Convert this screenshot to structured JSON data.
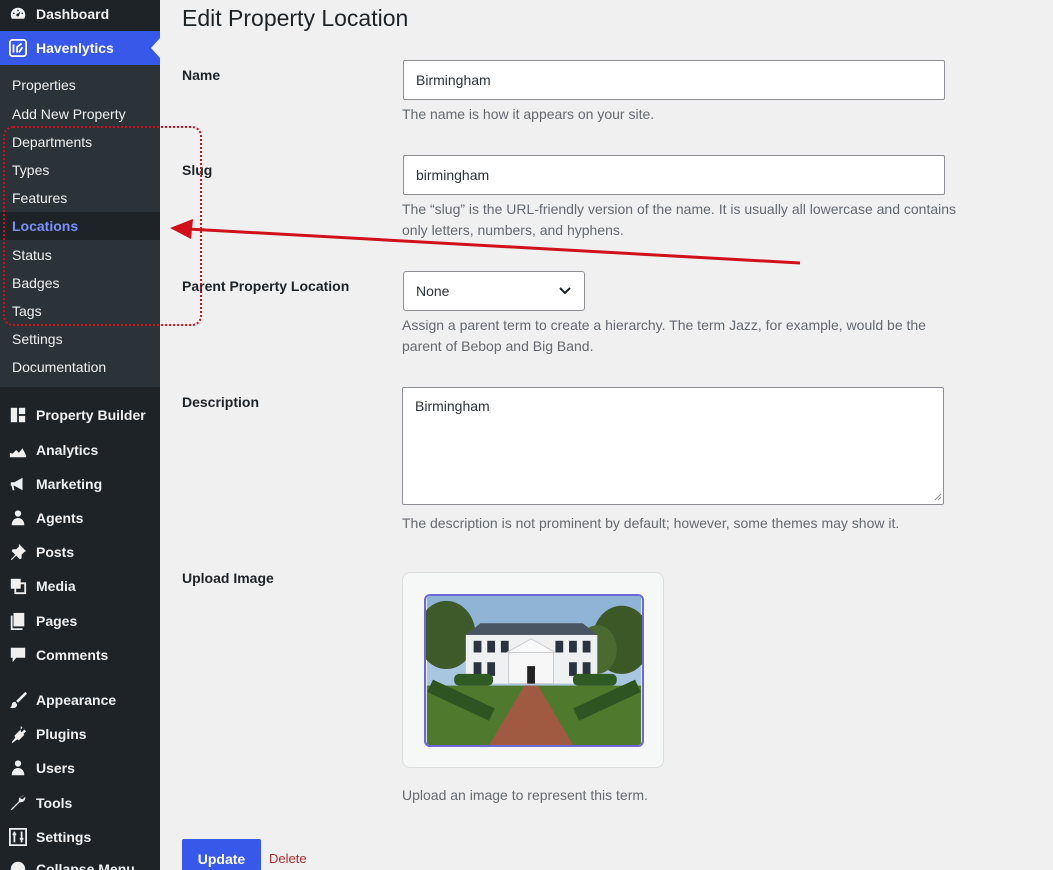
{
  "sidebar": {
    "top_items": [
      {
        "label": "Dashboard",
        "icon": "dashboard-icon"
      },
      {
        "label": "Havenlytics",
        "icon": "havenlytics-logo-icon"
      }
    ],
    "submenu": [
      {
        "label": "Properties"
      },
      {
        "label": "Add New Property"
      },
      {
        "label": "Departments"
      },
      {
        "label": "Types"
      },
      {
        "label": "Features"
      },
      {
        "label": "Locations",
        "current": true
      },
      {
        "label": "Status"
      },
      {
        "label": "Badges"
      },
      {
        "label": "Tags"
      },
      {
        "label": "Settings"
      },
      {
        "label": "Documentation"
      }
    ],
    "items": [
      {
        "label": "Property Builder",
        "icon": "grid-icon"
      },
      {
        "label": "Analytics",
        "icon": "chart-icon"
      },
      {
        "label": "Marketing",
        "icon": "megaphone-icon"
      },
      {
        "label": "Agents",
        "icon": "person-icon"
      },
      {
        "label": "Posts",
        "icon": "pin-icon"
      },
      {
        "label": "Media",
        "icon": "media-icon"
      },
      {
        "label": "Pages",
        "icon": "pages-icon"
      },
      {
        "label": "Comments",
        "icon": "comment-icon"
      },
      {
        "label": "Appearance",
        "icon": "brush-icon"
      },
      {
        "label": "Plugins",
        "icon": "plug-icon"
      },
      {
        "label": "Users",
        "icon": "users-icon"
      },
      {
        "label": "Tools",
        "icon": "wrench-icon"
      },
      {
        "label": "Settings",
        "icon": "sliders-icon"
      },
      {
        "label": "Collapse Menu",
        "icon": "collapse-icon"
      }
    ],
    "active_color": "#3858e9",
    "current_sub_color": "#7b90ff"
  },
  "page": {
    "title": "Edit Property Location"
  },
  "form": {
    "name": {
      "label": "Name",
      "value": "Birmingham",
      "help": "The name is how it appears on your site."
    },
    "slug": {
      "label": "Slug",
      "value": "birmingham",
      "help": "The “slug” is the URL-friendly version of the name. It is usually all lowercase and contains only letters, numbers, and hyphens."
    },
    "parent": {
      "label": "Parent Property Location",
      "selected": "None",
      "help": "Assign a parent term to create a hierarchy. The term Jazz, for example, would be the parent of Bebop and Big Band."
    },
    "description": {
      "label": "Description",
      "value": "Birmingham",
      "help": "The description is not prominent by default; however, some themes may show it."
    },
    "image": {
      "label": "Upload Image",
      "help": "Upload an image to represent this term.",
      "alt": "house-photo"
    },
    "update_label": "Update",
    "delete_label": "Delete"
  },
  "colors": {
    "admin_bar": "#1d2327",
    "primary": "#3858e9",
    "delete": "#b32d2e",
    "annotation": "#d0111b"
  }
}
